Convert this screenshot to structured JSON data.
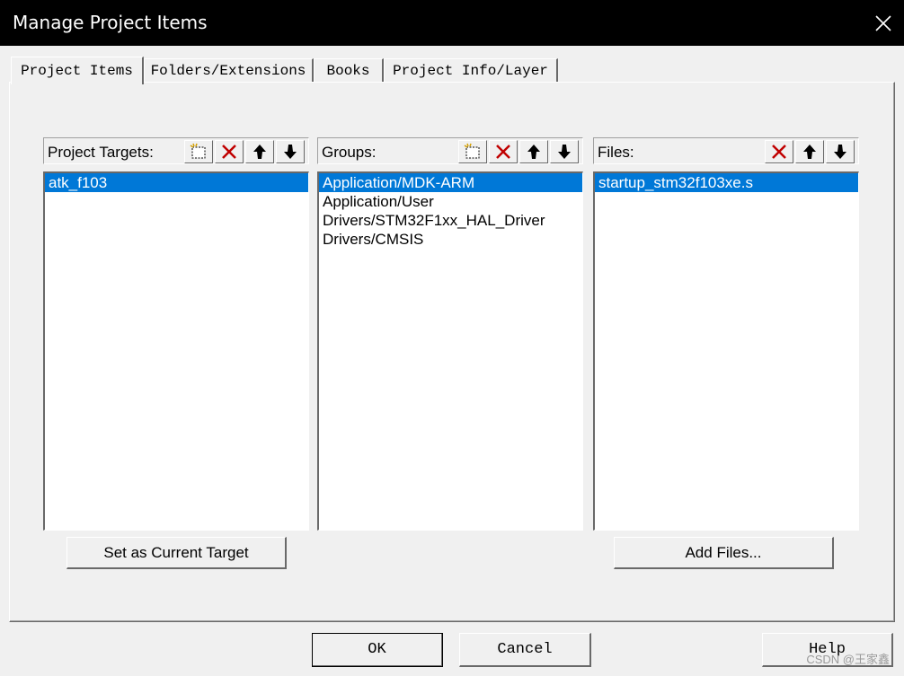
{
  "window": {
    "title": "Manage Project Items"
  },
  "tabs": [
    {
      "label": "Project Items"
    },
    {
      "label": "Folders/Extensions"
    },
    {
      "label": "Books"
    },
    {
      "label": "Project Info/Layer"
    }
  ],
  "targets": {
    "label": "Project Targets:",
    "items": [
      "atk_f103"
    ],
    "selected_index": 0,
    "button": "Set as Current Target"
  },
  "groups": {
    "label": "Groups:",
    "items": [
      "Application/MDK-ARM",
      "Application/User",
      "Drivers/STM32F1xx_HAL_Driver",
      "Drivers/CMSIS"
    ],
    "selected_index": 0
  },
  "files": {
    "label": "Files:",
    "items": [
      "startup_stm32f103xe.s"
    ],
    "selected_index": 0,
    "button": "Add Files..."
  },
  "buttons": {
    "ok": "OK",
    "cancel": "Cancel",
    "help": "Help"
  },
  "watermark": "CSDN @王家鑫",
  "colors": {
    "selection": "#0078d7",
    "delete_icon": "#c00000",
    "titlebar": "#000000"
  }
}
